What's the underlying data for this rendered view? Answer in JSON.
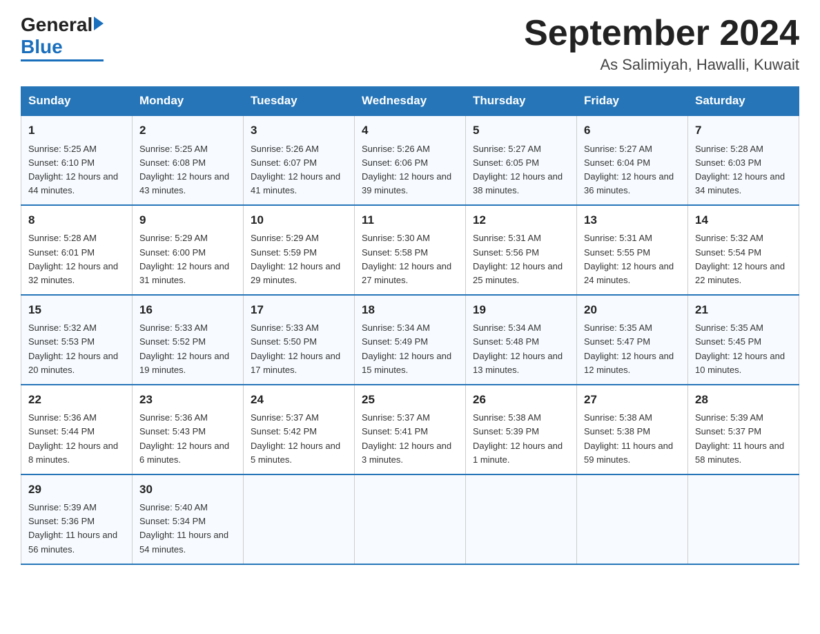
{
  "logo": {
    "general": "General",
    "blue": "Blue"
  },
  "title": "September 2024",
  "subtitle": "As Salimiyah, Hawalli, Kuwait",
  "headers": [
    "Sunday",
    "Monday",
    "Tuesday",
    "Wednesday",
    "Thursday",
    "Friday",
    "Saturday"
  ],
  "weeks": [
    [
      {
        "day": "1",
        "sunrise": "Sunrise: 5:25 AM",
        "sunset": "Sunset: 6:10 PM",
        "daylight": "Daylight: 12 hours and 44 minutes."
      },
      {
        "day": "2",
        "sunrise": "Sunrise: 5:25 AM",
        "sunset": "Sunset: 6:08 PM",
        "daylight": "Daylight: 12 hours and 43 minutes."
      },
      {
        "day": "3",
        "sunrise": "Sunrise: 5:26 AM",
        "sunset": "Sunset: 6:07 PM",
        "daylight": "Daylight: 12 hours and 41 minutes."
      },
      {
        "day": "4",
        "sunrise": "Sunrise: 5:26 AM",
        "sunset": "Sunset: 6:06 PM",
        "daylight": "Daylight: 12 hours and 39 minutes."
      },
      {
        "day": "5",
        "sunrise": "Sunrise: 5:27 AM",
        "sunset": "Sunset: 6:05 PM",
        "daylight": "Daylight: 12 hours and 38 minutes."
      },
      {
        "day": "6",
        "sunrise": "Sunrise: 5:27 AM",
        "sunset": "Sunset: 6:04 PM",
        "daylight": "Daylight: 12 hours and 36 minutes."
      },
      {
        "day": "7",
        "sunrise": "Sunrise: 5:28 AM",
        "sunset": "Sunset: 6:03 PM",
        "daylight": "Daylight: 12 hours and 34 minutes."
      }
    ],
    [
      {
        "day": "8",
        "sunrise": "Sunrise: 5:28 AM",
        "sunset": "Sunset: 6:01 PM",
        "daylight": "Daylight: 12 hours and 32 minutes."
      },
      {
        "day": "9",
        "sunrise": "Sunrise: 5:29 AM",
        "sunset": "Sunset: 6:00 PM",
        "daylight": "Daylight: 12 hours and 31 minutes."
      },
      {
        "day": "10",
        "sunrise": "Sunrise: 5:29 AM",
        "sunset": "Sunset: 5:59 PM",
        "daylight": "Daylight: 12 hours and 29 minutes."
      },
      {
        "day": "11",
        "sunrise": "Sunrise: 5:30 AM",
        "sunset": "Sunset: 5:58 PM",
        "daylight": "Daylight: 12 hours and 27 minutes."
      },
      {
        "day": "12",
        "sunrise": "Sunrise: 5:31 AM",
        "sunset": "Sunset: 5:56 PM",
        "daylight": "Daylight: 12 hours and 25 minutes."
      },
      {
        "day": "13",
        "sunrise": "Sunrise: 5:31 AM",
        "sunset": "Sunset: 5:55 PM",
        "daylight": "Daylight: 12 hours and 24 minutes."
      },
      {
        "day": "14",
        "sunrise": "Sunrise: 5:32 AM",
        "sunset": "Sunset: 5:54 PM",
        "daylight": "Daylight: 12 hours and 22 minutes."
      }
    ],
    [
      {
        "day": "15",
        "sunrise": "Sunrise: 5:32 AM",
        "sunset": "Sunset: 5:53 PM",
        "daylight": "Daylight: 12 hours and 20 minutes."
      },
      {
        "day": "16",
        "sunrise": "Sunrise: 5:33 AM",
        "sunset": "Sunset: 5:52 PM",
        "daylight": "Daylight: 12 hours and 19 minutes."
      },
      {
        "day": "17",
        "sunrise": "Sunrise: 5:33 AM",
        "sunset": "Sunset: 5:50 PM",
        "daylight": "Daylight: 12 hours and 17 minutes."
      },
      {
        "day": "18",
        "sunrise": "Sunrise: 5:34 AM",
        "sunset": "Sunset: 5:49 PM",
        "daylight": "Daylight: 12 hours and 15 minutes."
      },
      {
        "day": "19",
        "sunrise": "Sunrise: 5:34 AM",
        "sunset": "Sunset: 5:48 PM",
        "daylight": "Daylight: 12 hours and 13 minutes."
      },
      {
        "day": "20",
        "sunrise": "Sunrise: 5:35 AM",
        "sunset": "Sunset: 5:47 PM",
        "daylight": "Daylight: 12 hours and 12 minutes."
      },
      {
        "day": "21",
        "sunrise": "Sunrise: 5:35 AM",
        "sunset": "Sunset: 5:45 PM",
        "daylight": "Daylight: 12 hours and 10 minutes."
      }
    ],
    [
      {
        "day": "22",
        "sunrise": "Sunrise: 5:36 AM",
        "sunset": "Sunset: 5:44 PM",
        "daylight": "Daylight: 12 hours and 8 minutes."
      },
      {
        "day": "23",
        "sunrise": "Sunrise: 5:36 AM",
        "sunset": "Sunset: 5:43 PM",
        "daylight": "Daylight: 12 hours and 6 minutes."
      },
      {
        "day": "24",
        "sunrise": "Sunrise: 5:37 AM",
        "sunset": "Sunset: 5:42 PM",
        "daylight": "Daylight: 12 hours and 5 minutes."
      },
      {
        "day": "25",
        "sunrise": "Sunrise: 5:37 AM",
        "sunset": "Sunset: 5:41 PM",
        "daylight": "Daylight: 12 hours and 3 minutes."
      },
      {
        "day": "26",
        "sunrise": "Sunrise: 5:38 AM",
        "sunset": "Sunset: 5:39 PM",
        "daylight": "Daylight: 12 hours and 1 minute."
      },
      {
        "day": "27",
        "sunrise": "Sunrise: 5:38 AM",
        "sunset": "Sunset: 5:38 PM",
        "daylight": "Daylight: 11 hours and 59 minutes."
      },
      {
        "day": "28",
        "sunrise": "Sunrise: 5:39 AM",
        "sunset": "Sunset: 5:37 PM",
        "daylight": "Daylight: 11 hours and 58 minutes."
      }
    ],
    [
      {
        "day": "29",
        "sunrise": "Sunrise: 5:39 AM",
        "sunset": "Sunset: 5:36 PM",
        "daylight": "Daylight: 11 hours and 56 minutes."
      },
      {
        "day": "30",
        "sunrise": "Sunrise: 5:40 AM",
        "sunset": "Sunset: 5:34 PM",
        "daylight": "Daylight: 11 hours and 54 minutes."
      },
      null,
      null,
      null,
      null,
      null
    ]
  ]
}
